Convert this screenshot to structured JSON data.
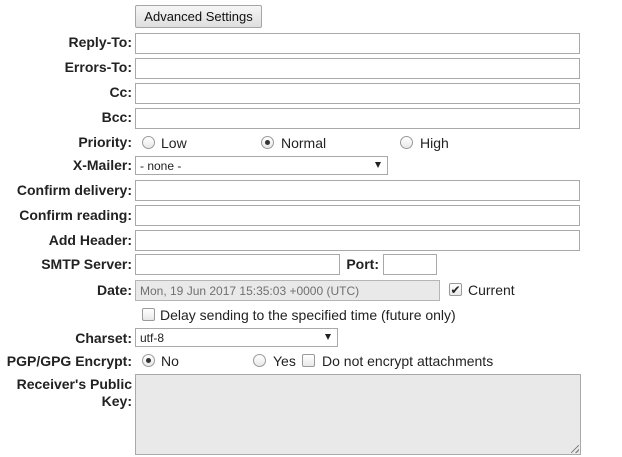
{
  "advanced_settings_button": "Advanced Settings",
  "labels": {
    "reply_to": "Reply-To:",
    "errors_to": "Errors-To:",
    "cc": "Cc:",
    "bcc": "Bcc:",
    "priority": "Priority:",
    "x_mailer": "X-Mailer:",
    "confirm_delivery": "Confirm delivery:",
    "confirm_reading": "Confirm reading:",
    "add_header": "Add Header:",
    "smtp_server": "SMTP Server:",
    "port": "Port:",
    "date": "Date:",
    "charset": "Charset:",
    "pgp_encrypt": "PGP/GPG Encrypt:",
    "receivers_public_key_line1": "Receiver's Public",
    "receivers_public_key_line2": "Key:"
  },
  "fields": {
    "reply_to": "",
    "errors_to": "",
    "cc": "",
    "bcc": "",
    "confirm_delivery": "",
    "confirm_reading": "",
    "add_header": "",
    "smtp_server": "",
    "port": "",
    "receivers_public_key": ""
  },
  "priority": {
    "options": [
      "Low",
      "Normal",
      "High"
    ],
    "selected": "Normal"
  },
  "x_mailer": {
    "selected": "- none -"
  },
  "date": {
    "value": "Mon, 19 Jun 2017 15:35:03 +0000 (UTC)",
    "current_label": "Current",
    "current_checked": true
  },
  "delay": {
    "label": "Delay sending to the specified time (future only)",
    "checked": false
  },
  "charset": {
    "selected": "utf-8"
  },
  "pgp": {
    "no_label": "No",
    "yes_label": "Yes",
    "selected": "No",
    "no_encrypt_attachments_label": "Do not encrypt attachments",
    "no_encrypt_attachments_checked": false
  }
}
